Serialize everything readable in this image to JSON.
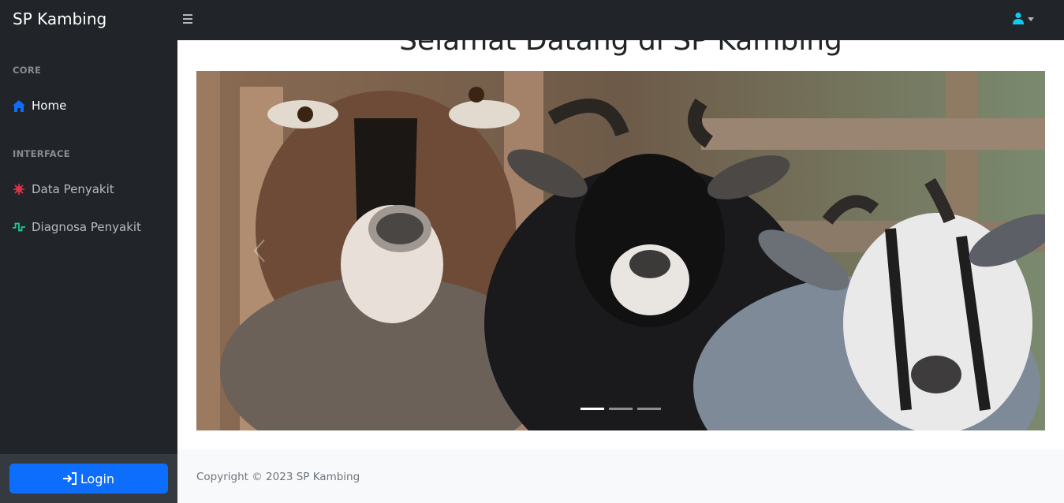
{
  "navbar": {
    "brand": "SP Kambing",
    "toggle_icon": "bars-icon",
    "user_icon": "user-icon",
    "accent": "#0dcaf0"
  },
  "sidebar": {
    "sections": [
      {
        "heading": "CORE",
        "items": [
          {
            "label": "Home",
            "icon": "home-icon",
            "icon_color": "#0d6efd",
            "active": true
          }
        ]
      },
      {
        "heading": "INTERFACE",
        "items": [
          {
            "label": "Data Penyakit",
            "icon": "virus-icon",
            "icon_color": "#dc3545",
            "active": false
          },
          {
            "label": "Diagnosa Penyakit",
            "icon": "heartbeat-icon",
            "icon_color": "#20c997",
            "active": false
          }
        ]
      }
    ],
    "footer": {
      "login_label": "Login",
      "login_icon": "sign-in-icon"
    }
  },
  "main": {
    "title": "Selamat Datang di SP Kambing",
    "carousel": {
      "slide_count": 3,
      "active_index": 0
    },
    "footer_text": "Copyright © 2023 SP Kambing"
  },
  "colors": {
    "dark": "#212529",
    "primary": "#0d6efd"
  }
}
